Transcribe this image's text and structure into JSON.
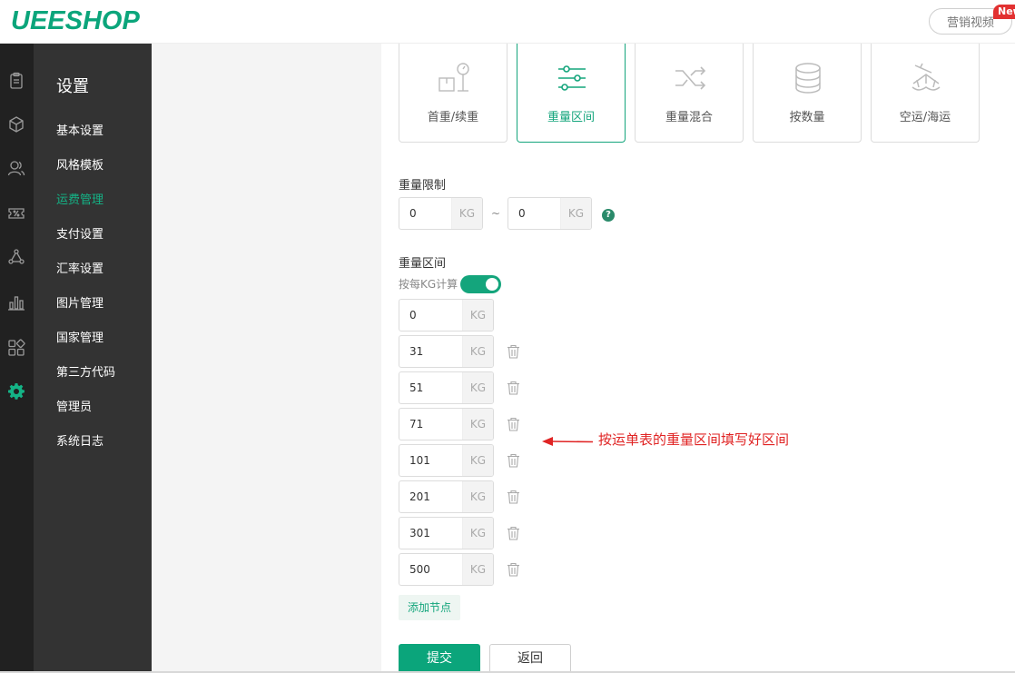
{
  "header": {
    "logo": "UEESHOP",
    "video_button": "营销视频",
    "new_badge": "New"
  },
  "rail": {
    "icons": [
      "clipboard-icon",
      "cube-icon",
      "users-icon",
      "percent-ticket-icon",
      "nodes-icon",
      "bar-chart-icon",
      "apps-icon",
      "gear-icon"
    ],
    "active_icon": "gear-icon",
    "active_color": "#14b386"
  },
  "menu": {
    "title": "设置",
    "items": [
      {
        "label": "基本设置"
      },
      {
        "label": "风格模板"
      },
      {
        "label": "运费管理",
        "active": true
      },
      {
        "label": "支付设置"
      },
      {
        "label": "汇率设置"
      },
      {
        "label": "图片管理"
      },
      {
        "label": "国家管理"
      },
      {
        "label": "第三方代码"
      },
      {
        "label": "管理员"
      },
      {
        "label": "系统日志"
      }
    ]
  },
  "shipping_types": [
    {
      "label": "首重/续重",
      "icon": "box-scale-icon"
    },
    {
      "label": "重量区间",
      "icon": "sliders-icon",
      "active": true
    },
    {
      "label": "重量混合",
      "icon": "shuffle-icon"
    },
    {
      "label": "按数量",
      "icon": "stack-icon"
    },
    {
      "label": "空运/海运",
      "icon": "ship-icon"
    }
  ],
  "weight_limit": {
    "label": "重量限制",
    "min": "0",
    "max": "0",
    "unit": "KG",
    "separator": "~",
    "help": "?"
  },
  "weight_range": {
    "label": "重量区间",
    "toggle_label": "按每KG计算",
    "toggle_on": true,
    "unit": "KG",
    "nodes": [
      "0",
      "31",
      "51",
      "71",
      "101",
      "201",
      "301",
      "500"
    ],
    "add_node": "添加节点"
  },
  "annotation": "按运单表的重量区间填写好区间",
  "actions": {
    "submit": "提交",
    "back": "返回"
  },
  "colors": {
    "brand": "#0ba57b",
    "annotation": "#e02424"
  }
}
